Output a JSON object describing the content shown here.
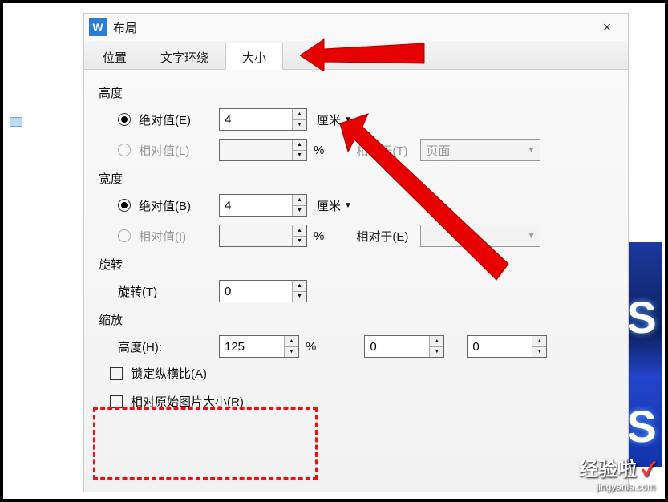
{
  "dialog": {
    "app_icon": "W",
    "title": "布局",
    "close": "×"
  },
  "tabs": {
    "position": "位置",
    "textwrap": "文字环绕",
    "size": "大小"
  },
  "height": {
    "label": "高度",
    "abs_label": "绝对值(E)",
    "abs_value": "4",
    "abs_unit": "厘米",
    "rel_label": "相对值(L)",
    "rel_value": "",
    "rel_unit": "%",
    "rel_to_label": "相对于(T)",
    "rel_to_value": "页面"
  },
  "width": {
    "label": "宽度",
    "abs_label": "绝对值(B)",
    "abs_value": "4",
    "abs_unit": "厘米",
    "rel_label": "相对值(I)",
    "rel_value": "",
    "rel_unit": "%",
    "rel_to_label": "相对于(E)",
    "rel_to_value": ""
  },
  "rotate": {
    "label": "旋转",
    "field_label": "旋转(T)",
    "value": "0"
  },
  "scale": {
    "label": "缩放",
    "h_label": "高度(H):",
    "h_value": "125",
    "h_unit": "%",
    "w_value": "0",
    "x_value": "0"
  },
  "opts": {
    "lock": "锁定纵横比(A)",
    "original": "相对原始图片大小(R)"
  },
  "watermark": {
    "line1": "经验啦",
    "check": "✓",
    "line2": "jingyanla.com"
  },
  "bg": {
    "s1": "S",
    "s2": "S"
  }
}
